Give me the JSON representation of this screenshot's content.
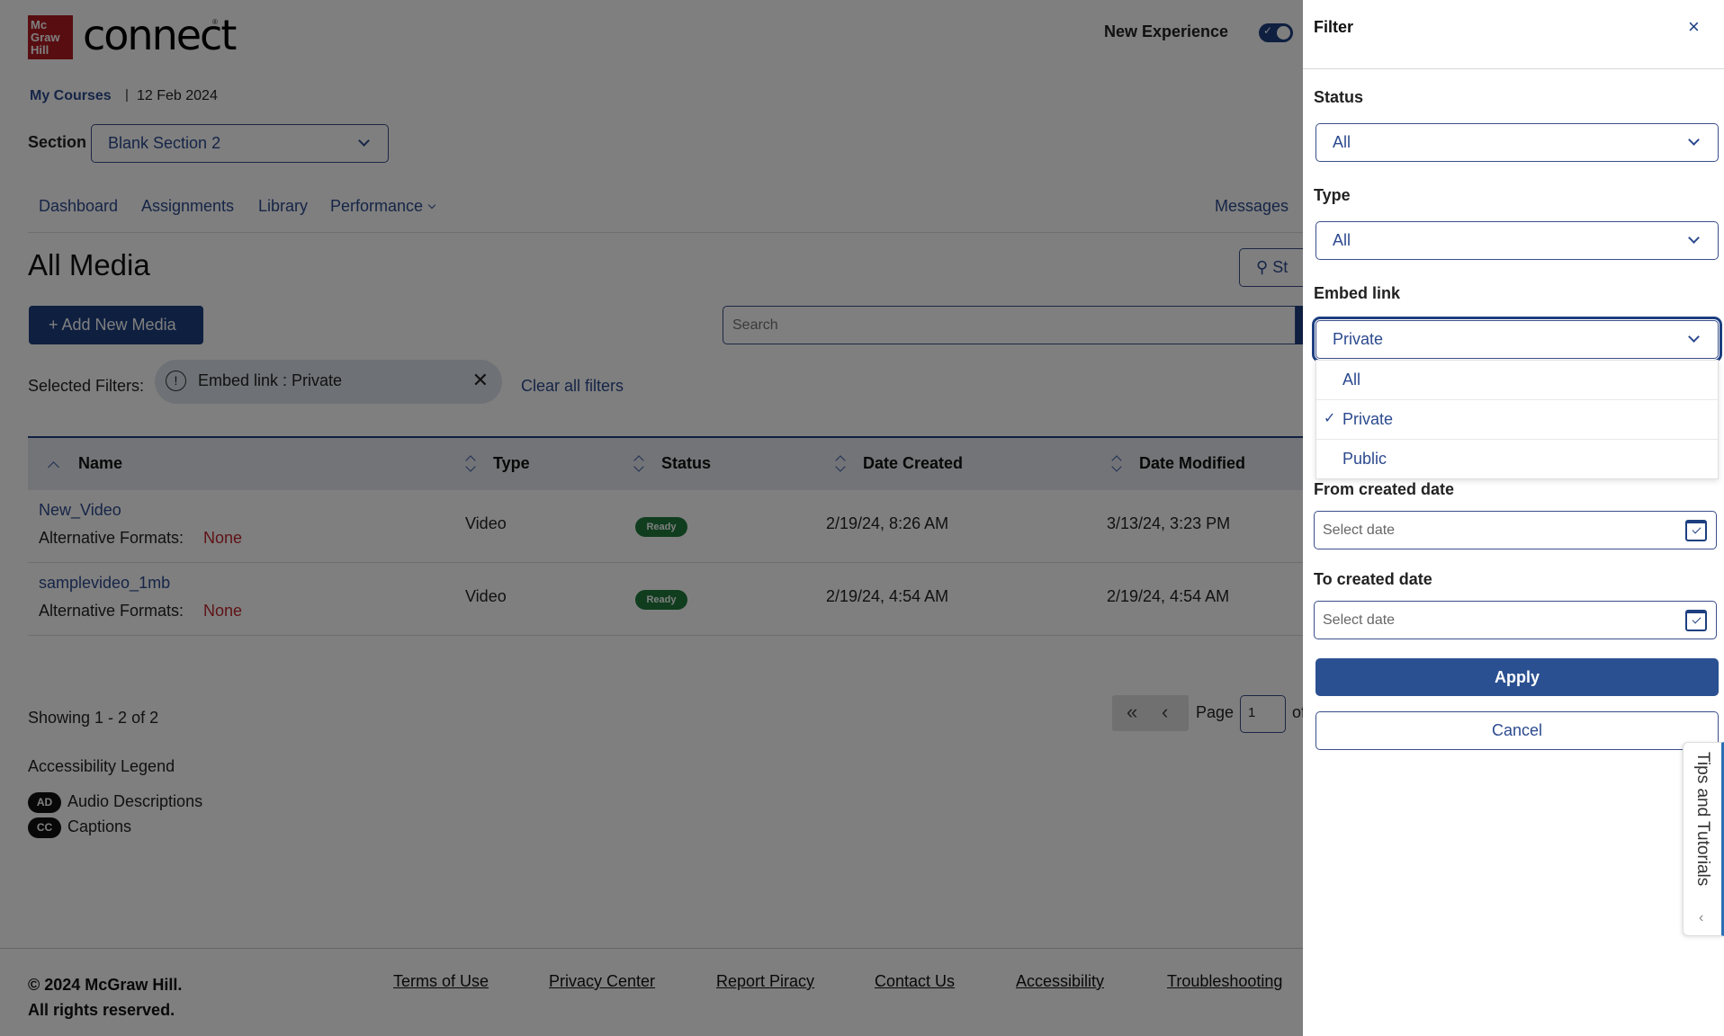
{
  "header": {
    "logo_box_lines": [
      "Mc",
      "Graw",
      "Hill"
    ],
    "logo_word": "connect",
    "logo_reg": "®",
    "new_experience_label": "New Experience",
    "new_experience_on": true
  },
  "breadcrumb": {
    "link": "My Courses",
    "separator": "|",
    "date": "12 Feb 2024"
  },
  "section": {
    "label": "Section",
    "value": "Blank Section 2"
  },
  "nav": {
    "items": [
      "Dashboard",
      "Assignments",
      "Library",
      "Performance"
    ],
    "messages": "Messages"
  },
  "main": {
    "title": "All Media",
    "student_view_partial": "St",
    "add_button": "+ Add New Media",
    "search_placeholder": "Search",
    "selected_filters_label": "Selected Filters:",
    "chip_label": "Embed link : Private",
    "chip_info_glyph": "!",
    "chip_close_glyph": "✕",
    "clear_all": "Clear all filters"
  },
  "table": {
    "columns": [
      "Name",
      "Type",
      "Status",
      "Date Created",
      "Date Modified"
    ],
    "rows": [
      {
        "name": "New_Video",
        "alt_label": "Alternative Formats:",
        "alt_value": "None",
        "type": "Video",
        "status": "Ready",
        "created": "2/19/24, 8:26 AM",
        "modified": "3/13/24, 3:23 PM"
      },
      {
        "name": "samplevideo_1mb",
        "alt_label": "Alternative Formats:",
        "alt_value": "None",
        "type": "Video",
        "status": "Ready",
        "created": "2/19/24, 4:54 AM",
        "modified": "2/19/24, 4:54 AM"
      }
    ]
  },
  "pagination": {
    "showing": "Showing 1 - 2 of 2",
    "first_glyph": "«",
    "prev_glyph": "‹",
    "page_label": "Page",
    "page_value": "1",
    "of_partial": "of"
  },
  "legend": {
    "title": "Accessibility Legend",
    "items": [
      {
        "badge": "AD",
        "label": "Audio Descriptions"
      },
      {
        "badge": "CC",
        "label": "Captions"
      }
    ]
  },
  "footer": {
    "copyright": "© 2024 McGraw Hill.",
    "rights": "All rights reserved.",
    "links": [
      "Terms of Use",
      "Privacy Center",
      "Report Piracy",
      "Contact Us",
      "Accessibility",
      "Troubleshooting"
    ]
  },
  "filter_panel": {
    "title": "Filter",
    "close_glyph": "×",
    "status": {
      "label": "Status",
      "value": "All"
    },
    "type": {
      "label": "Type",
      "value": "All"
    },
    "embed_link": {
      "label": "Embed link",
      "value": "Private",
      "options": [
        "All",
        "Private",
        "Public"
      ],
      "selected": "Private"
    },
    "from_date": {
      "label": "From created date",
      "placeholder": "Select date"
    },
    "to_date": {
      "label": "To created date",
      "placeholder": "Select date"
    },
    "apply": "Apply",
    "cancel": "Cancel",
    "check_glyph": "✓"
  },
  "tips_tab": {
    "label": "Tips and Tutorials",
    "chevron_glyph": "‹"
  },
  "colors": {
    "brand_red": "#b01c22",
    "primary_blue": "#1d3f80",
    "link_blue": "#2c4a8f",
    "ready_green": "#1e7a3c",
    "none_red": "#c0272d"
  }
}
